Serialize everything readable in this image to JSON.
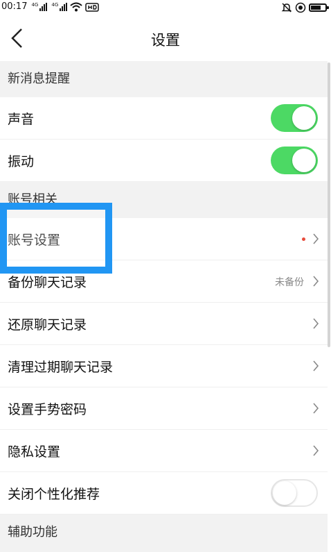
{
  "status": {
    "time": "00:17",
    "net1": "4G",
    "net2": "4G"
  },
  "nav": {
    "title": "设置"
  },
  "sections": {
    "notifications": "新消息提醒",
    "account": "账号相关",
    "accessibility": "辅助功能"
  },
  "rows": {
    "sound": {
      "label": "声音",
      "on": true
    },
    "vibration": {
      "label": "振动",
      "on": true
    },
    "account_settings": {
      "label": "账号设置"
    },
    "backup": {
      "label": "备份聊天记录",
      "note": "未备份"
    },
    "restore": {
      "label": "还原聊天记录"
    },
    "cleanup": {
      "label": "清理过期聊天记录"
    },
    "gesture": {
      "label": "设置手势密码"
    },
    "privacy": {
      "label": "隐私设置"
    },
    "personalization": {
      "label": "关闭个性化推荐",
      "on": false
    }
  },
  "colors": {
    "toggle_on": "#4cd964",
    "highlight": "#2196f3",
    "badge": "#e74c3c"
  }
}
